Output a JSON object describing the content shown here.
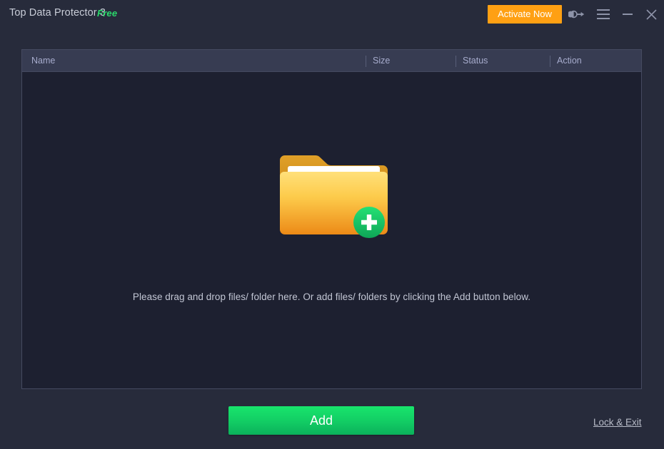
{
  "window": {
    "title": "Top Data Protector 3",
    "edition_badge": "Free",
    "bg_color": "#272b3b",
    "panel_bg_color": "#1d2030",
    "panel_border_color": "#454a60"
  },
  "titlebar": {
    "activate_label": "Activate Now",
    "activate_color": "#ffa013",
    "icons": [
      {
        "name": "key-icon",
        "label": "Key"
      },
      {
        "name": "menu-icon",
        "label": "Menu"
      },
      {
        "name": "minimize-icon",
        "label": "Minimize"
      },
      {
        "name": "close-icon",
        "label": "Close"
      }
    ]
  },
  "file_list": {
    "columns": [
      {
        "key": "name",
        "label": "Name"
      },
      {
        "key": "size",
        "label": "Size"
      },
      {
        "key": "status",
        "label": "Status"
      },
      {
        "key": "action",
        "label": "Action"
      }
    ],
    "rows": [],
    "header_bg_color": "#373c52",
    "header_text_color": "#a7accd"
  },
  "empty_state": {
    "icon": "folder-add-icon",
    "hint": "Please drag and drop files/ folder here. Or add files/ folders by clicking the Add button below.",
    "folder_colors": {
      "tab": "#d89520",
      "sheet": "#ffffff",
      "front_top": "#ffd95e",
      "front_bottom": "#ee8c18"
    },
    "badge_colors": {
      "top": "#20dc6d",
      "bottom": "#0fa95a",
      "plus": "#ffffff"
    }
  },
  "footer": {
    "add_label": "Add",
    "add_color": "#12cc64",
    "lock_exit_label": "Lock & Exit"
  }
}
